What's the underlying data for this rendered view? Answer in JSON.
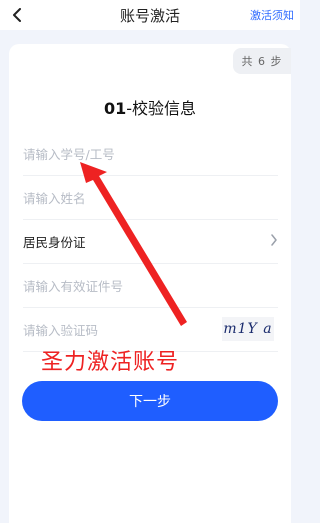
{
  "header": {
    "title": "账号激活",
    "notice_link": "激活须知",
    "back_icon": "chevron-left-icon"
  },
  "progress": {
    "total_label": "共 6 步"
  },
  "step": {
    "number": "01",
    "separator": "-",
    "title": "校验信息"
  },
  "form": {
    "student_id_placeholder": "请输入学号/工号",
    "name_placeholder": "请输入姓名",
    "id_type_value": "居民身份证",
    "id_number_placeholder": "请输入有效证件号",
    "code_placeholder": "请输入验证码",
    "captcha_text": "m1Y a"
  },
  "annotation": {
    "text": "圣力激活账号",
    "color": "#ee2222"
  },
  "actions": {
    "next_label": "下一步"
  },
  "colors": {
    "accent": "#1f5eff",
    "link": "#2f6bff",
    "background": "#f1f4fb"
  }
}
